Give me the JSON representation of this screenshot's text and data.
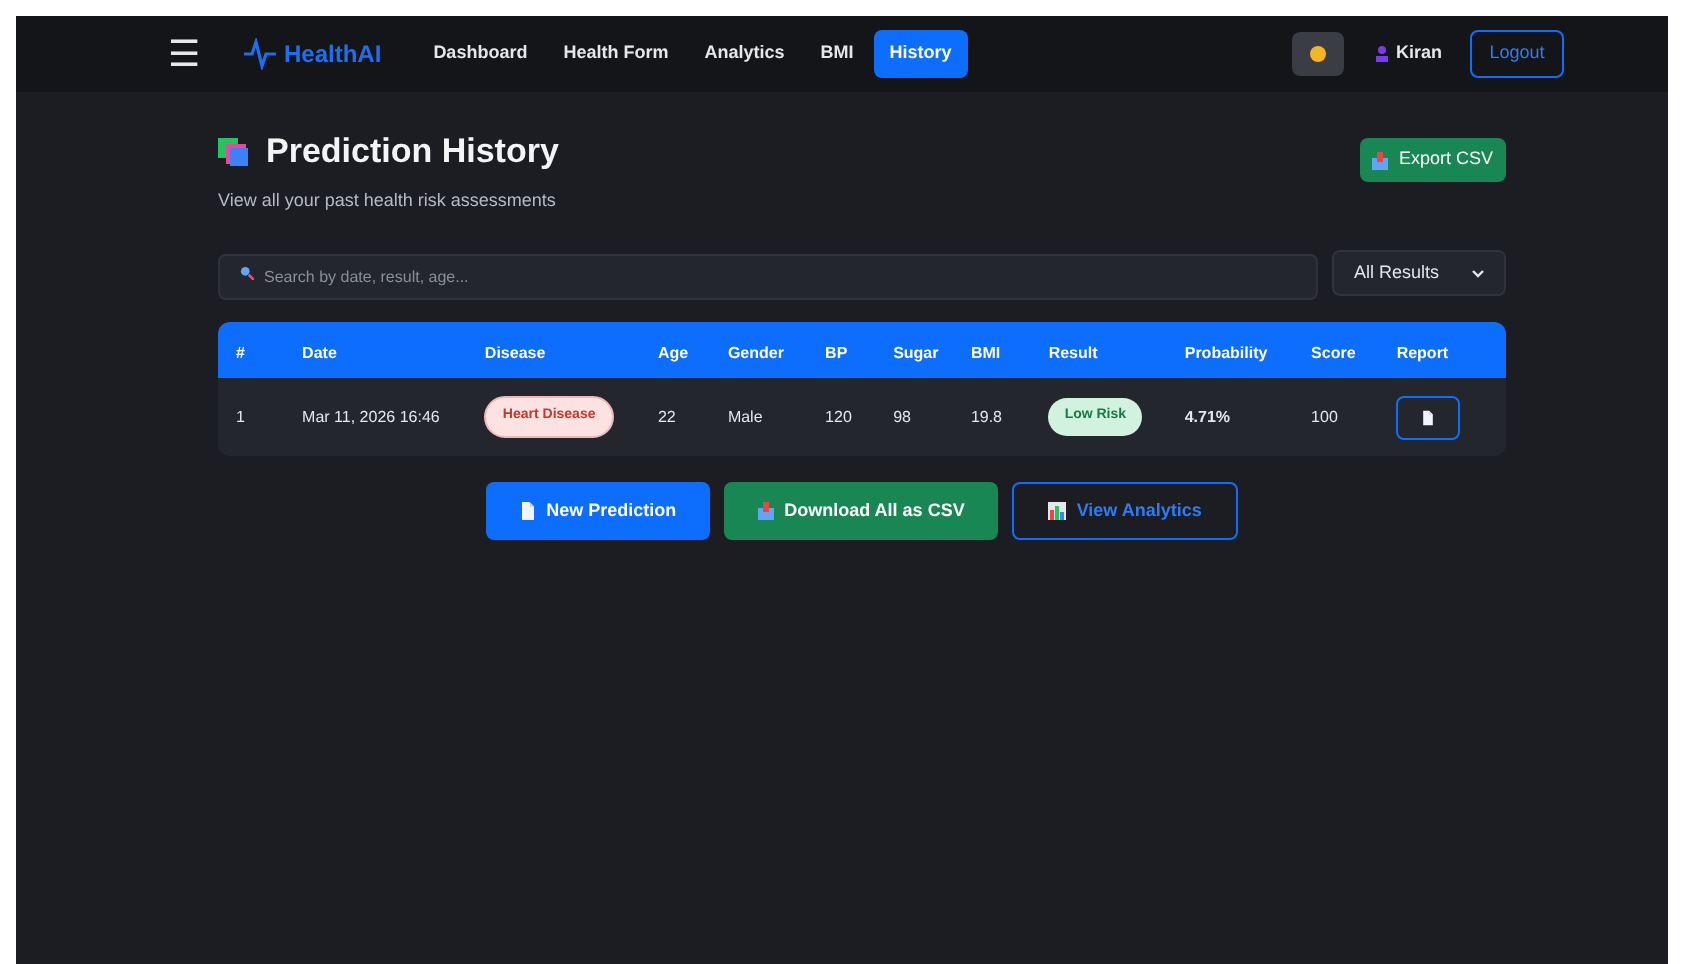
{
  "nav": {
    "menu": "☰",
    "brand": "HealthAI",
    "links": [
      {
        "label": "Dashboard",
        "selected": false
      },
      {
        "label": "Health Form",
        "selected": false
      },
      {
        "label": "Analytics",
        "selected": false
      },
      {
        "label": "BMI",
        "selected": false
      },
      {
        "label": "History",
        "selected": true
      }
    ],
    "user": "Kiran",
    "logout": "Logout"
  },
  "header": {
    "title": "Prediction History",
    "subtitle": "View all your past health risk assessments",
    "export": "Export CSV"
  },
  "search": {
    "placeholder": "Search by date, result, age...",
    "filter": "All Results"
  },
  "table": {
    "columns": [
      "#",
      "Date",
      "Disease",
      "Age",
      "Gender",
      "BP",
      "Sugar",
      "BMI",
      "Result",
      "Probability",
      "Score",
      "Report"
    ],
    "rows": [
      {
        "index": "1",
        "date": "Mar 11, 2026 16:46",
        "disease": "Heart Disease",
        "age": "22",
        "gender": "Male",
        "bp": "120",
        "sugar": "98",
        "bmi": "19.8",
        "result": "Low Risk",
        "kind": "low",
        "probability": "4.71%",
        "score": "100"
      }
    ]
  },
  "actions": [
    {
      "label": "New Prediction",
      "kind": "primary"
    },
    {
      "label": "Download All as CSV",
      "kind": "success"
    },
    {
      "label": "View Analytics",
      "kind": "outline"
    }
  ]
}
